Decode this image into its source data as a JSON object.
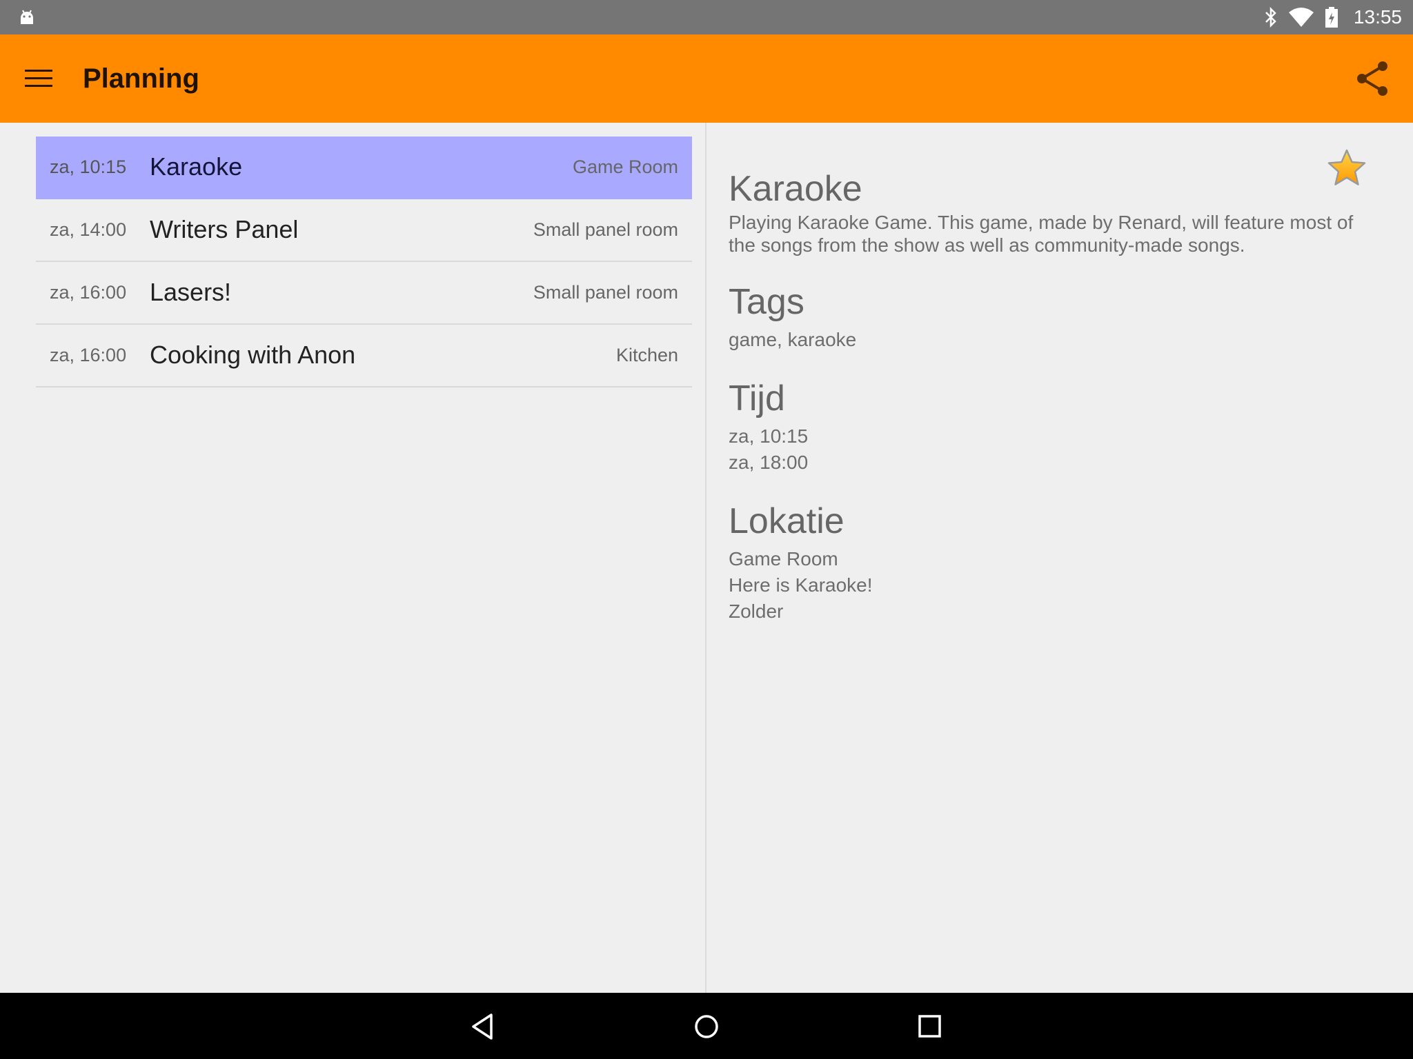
{
  "status_bar": {
    "time": "13:55",
    "icons": [
      "android-debug-icon",
      "bluetooth-icon",
      "wifi-icon",
      "battery-icon"
    ]
  },
  "toolbar": {
    "title": "Planning",
    "menu_icon": "hamburger-menu-icon",
    "share_icon": "share-icon",
    "background": "#ff8a00"
  },
  "events": [
    {
      "time": "za, 10:15",
      "name": "Karaoke",
      "room": "Game Room",
      "selected": true
    },
    {
      "time": "za, 14:00",
      "name": "Writers Panel",
      "room": "Small panel room",
      "selected": false
    },
    {
      "time": "za, 16:00",
      "name": "Lasers!",
      "room": "Small panel room",
      "selected": false
    },
    {
      "time": "za, 16:00",
      "name": "Cooking with Anon",
      "room": "Kitchen",
      "selected": false
    }
  ],
  "detail": {
    "title": "Karaoke",
    "description": "Playing Karaoke Game. This game, made by Renard, will feature most of the songs from the show as well as community-made songs.",
    "favorite_icon": "star-icon",
    "tags_heading": "Tags",
    "tags": "game, karaoke",
    "time_heading": "Tijd",
    "time_start": "za, 10:15",
    "time_end": "za, 18:00",
    "location_heading": "Lokatie",
    "location_lines": [
      "Game Room",
      "Here is Karaoke!",
      "Zolder"
    ]
  },
  "colors": {
    "accent": "#ff8a00",
    "selected_row": "#a9aaff",
    "star": "#ffb300"
  },
  "nav_bar": {
    "icons": [
      "back-icon",
      "home-icon",
      "recents-icon"
    ]
  }
}
